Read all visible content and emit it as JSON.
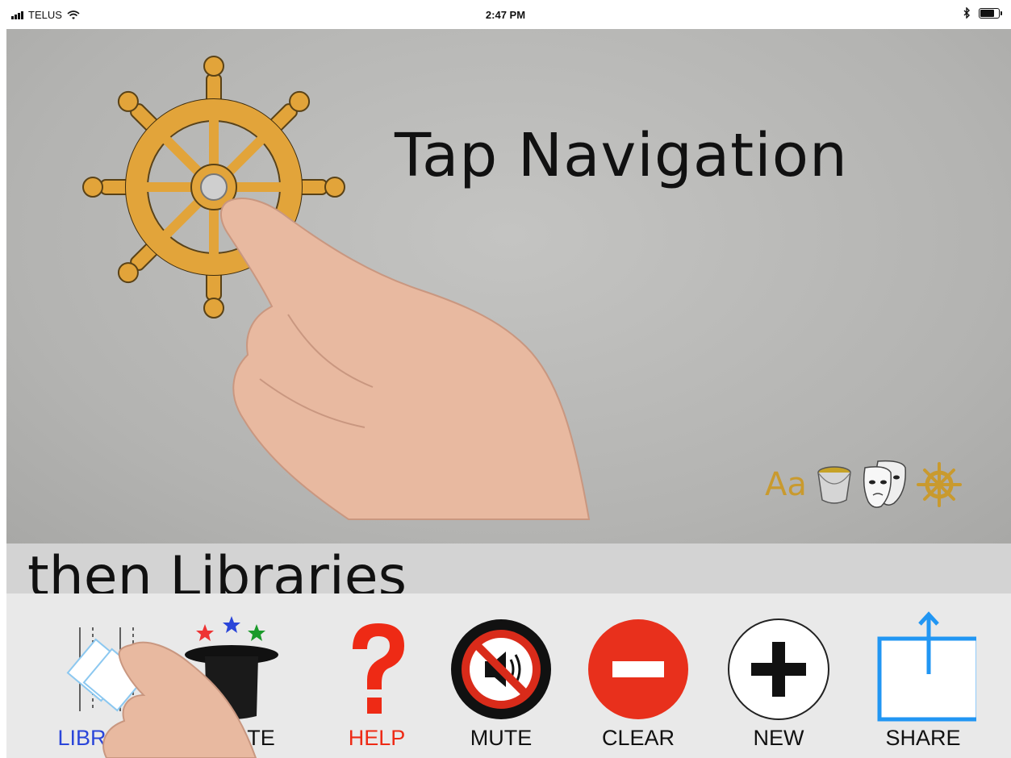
{
  "status_bar": {
    "carrier": "TELUS",
    "time": "2:47 PM"
  },
  "screen": {
    "title": "Tap Navigation",
    "caption": "then Libraries",
    "tool_icons": {
      "text_style": "Aa",
      "paint_bucket": "paint-bucket-icon",
      "masks": "theater-masks-icon",
      "wheel": "ship-wheel-icon"
    }
  },
  "toolbar": {
    "library_label": "LIBRARY",
    "create_label": "CREATE",
    "help_label": "HELP",
    "mute_label": "MUTE",
    "clear_label": "CLEAR",
    "new_label": "NEW",
    "share_label": "SHARE"
  },
  "colors": {
    "wheel_gold": "#e2a43a",
    "help_red": "#ee2a15",
    "clear_red": "#e8301c",
    "share_blue": "#2196f3",
    "library_label_blue": "#2a45d9"
  }
}
